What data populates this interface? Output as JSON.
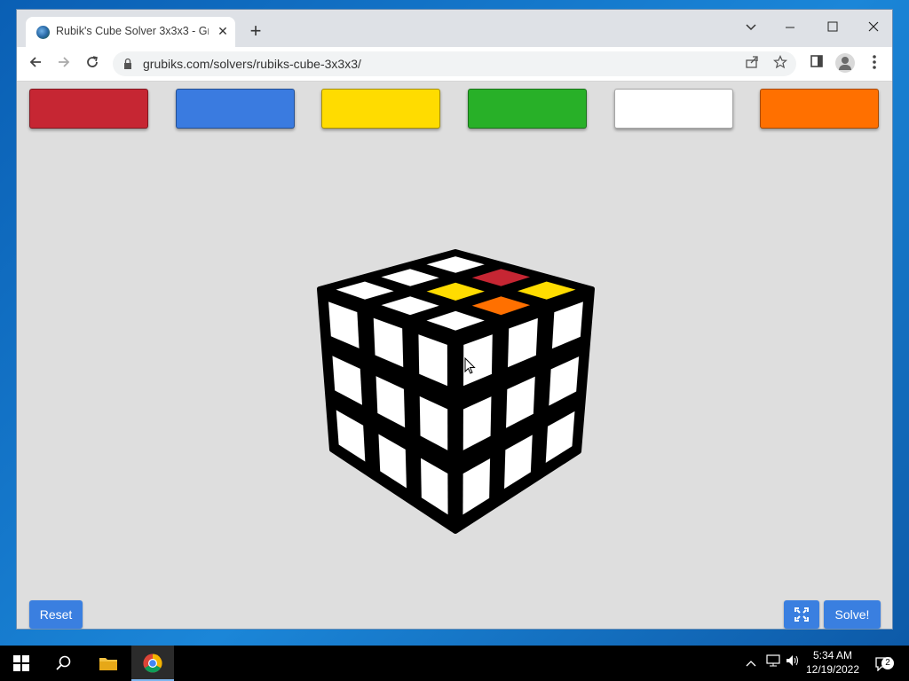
{
  "browser": {
    "tab_title": "Rubik's Cube Solver 3x3x3 - Grubiks",
    "tab_close": "✕",
    "new_tab": "+",
    "url": "grubiks.com/solvers/rubiks-cube-3x3x3/",
    "window_controls": {
      "chevron": "⌄",
      "minimize": "–",
      "maximize": "☐",
      "close": "✕"
    }
  },
  "palette": {
    "colors": [
      {
        "name": "red",
        "hex": "#c62633"
      },
      {
        "name": "blue",
        "hex": "#3a7be0"
      },
      {
        "name": "yellow",
        "hex": "#ffdc00"
      },
      {
        "name": "green",
        "hex": "#28b028"
      },
      {
        "name": "white",
        "hex": "#ffffff"
      },
      {
        "name": "orange",
        "hex": "#ff7000"
      }
    ]
  },
  "cube": {
    "top_face": [
      [
        "white",
        "red",
        "yellow"
      ],
      [
        "white",
        "yellow",
        "orange"
      ],
      [
        "white",
        "white",
        "white"
      ]
    ],
    "left_face": [
      [
        "white",
        "white",
        "white"
      ],
      [
        "white",
        "white",
        "white"
      ],
      [
        "white",
        "white",
        "white"
      ]
    ],
    "right_face": [
      [
        "white",
        "white",
        "white"
      ],
      [
        "white",
        "white",
        "white"
      ],
      [
        "white",
        "white",
        "white"
      ]
    ]
  },
  "buttons": {
    "reset": "Reset",
    "fullscreen_icon": "fullscreen-icon",
    "solve": "Solve!"
  },
  "taskbar": {
    "time": "5:34 AM",
    "date": "12/19/2022",
    "notification_count": "2"
  }
}
